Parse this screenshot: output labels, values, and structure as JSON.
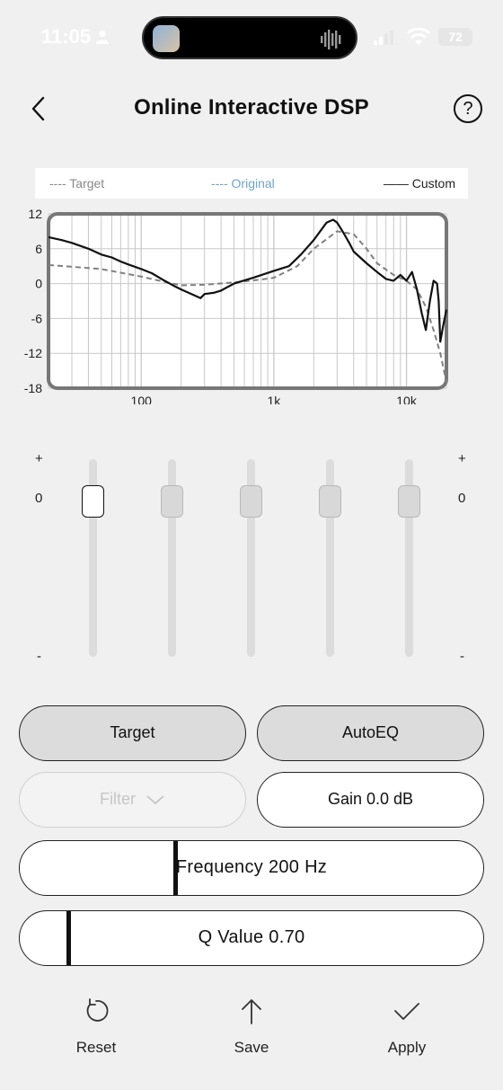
{
  "status_bar": {
    "time": "11:05",
    "battery": "72"
  },
  "header": {
    "title": "Online Interactive DSP",
    "help": "?"
  },
  "legend": {
    "target": "---- Target",
    "original": "---- Original",
    "custom": "—— Custom"
  },
  "chart_data": {
    "type": "line",
    "x_scale": "log",
    "xlim": [
      20,
      20000
    ],
    "ylim": [
      -18,
      12
    ],
    "x_tick_labels": [
      "100",
      "1k",
      "10k"
    ],
    "x_tick_values": [
      100,
      1000,
      10000
    ],
    "y_tick_labels": [
      "12",
      "6",
      "0",
      "-6",
      "-12",
      "-18"
    ],
    "y_tick_values": [
      12,
      6,
      0,
      -6,
      -12,
      -18
    ],
    "grid": true,
    "series": [
      {
        "name": "Target",
        "style": "dashed",
        "color": "#808080",
        "x": [
          20,
          50,
          100,
          150,
          200,
          300,
          500,
          800,
          1000,
          1500,
          2000,
          3000,
          4000,
          5000,
          6000,
          8000,
          10000,
          12000,
          14000,
          16000,
          18000,
          20000
        ],
        "y": [
          3.2,
          2.5,
          1.2,
          0.3,
          -0.3,
          -0.2,
          0.2,
          0.7,
          1.0,
          3.0,
          6.0,
          9.0,
          8.5,
          6.0,
          3.5,
          1.5,
          0.5,
          -1.0,
          -4.0,
          -8.0,
          -12.0,
          -17.0
        ]
      },
      {
        "name": "Custom",
        "style": "solid",
        "color": "#111111",
        "x": [
          20,
          25,
          30,
          40,
          50,
          60,
          70,
          80,
          100,
          120,
          150,
          180,
          200,
          250,
          280,
          300,
          350,
          400,
          500,
          700,
          1000,
          1300,
          1600,
          2000,
          2500,
          2800,
          3000,
          3300,
          3700,
          4000,
          5000,
          6000,
          7000,
          8000,
          9000,
          10000,
          11000,
          12000,
          13000,
          14000,
          15000,
          16000,
          17000,
          17500,
          18000,
          19000,
          20000
        ],
        "y": [
          8,
          7.5,
          7,
          6,
          5,
          4.5,
          3.8,
          3.3,
          2.5,
          1.8,
          0.5,
          -0.5,
          -1.0,
          -2.0,
          -2.5,
          -1.8,
          -1.6,
          -1.2,
          0,
          1.0,
          2.2,
          3.0,
          5.0,
          7.5,
          10.5,
          11.0,
          10.5,
          9.0,
          7.0,
          5.5,
          3.5,
          2.0,
          0.8,
          0.5,
          1.5,
          0.5,
          2.0,
          -1.0,
          -5.0,
          -8.0,
          -3.0,
          0.5,
          0.0,
          -3.0,
          -10.0,
          -7.0,
          -4.5
        ]
      }
    ]
  },
  "equalizer": {
    "plus_label": "+",
    "zero_label": "0",
    "minus_label": "-",
    "sliders": [
      {
        "value": 0,
        "selected": true
      },
      {
        "value": 0,
        "selected": false
      },
      {
        "value": 0,
        "selected": false
      },
      {
        "value": 0,
        "selected": false
      },
      {
        "value": 0,
        "selected": false
      }
    ]
  },
  "controls": {
    "target_button": "Target",
    "autoeq_button": "AutoEQ",
    "filter_button": "Filter",
    "gain_button": "Gain 0.0 dB",
    "frequency_label": "Frequency 200 Hz",
    "frequency_fraction": 0.33,
    "q_label": "Q Value 0.70",
    "q_fraction": 0.1
  },
  "actions": {
    "reset": "Reset",
    "save": "Save",
    "apply": "Apply"
  }
}
